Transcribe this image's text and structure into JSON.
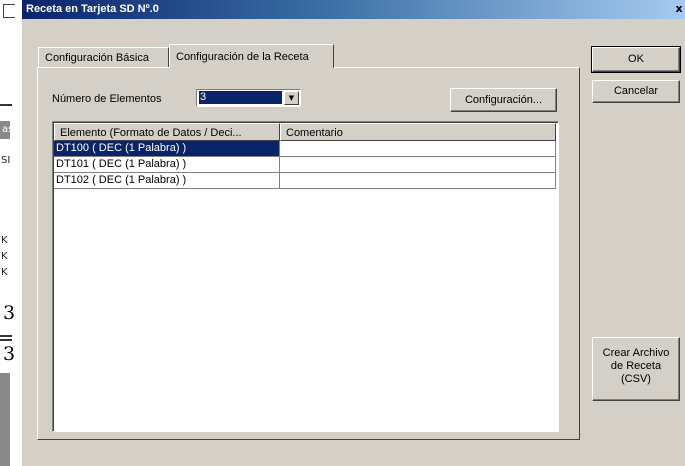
{
  "window": {
    "title": "Receta en Tarjeta SD Nº.0",
    "close_glyph": "x"
  },
  "tabs": [
    {
      "label": "Configuración Básica",
      "active": false
    },
    {
      "label": "Configuración de la Receta",
      "active": true
    }
  ],
  "recipe": {
    "count_label": "Número de Elementos",
    "count_value": "3",
    "config_button": "Configuración...",
    "columns": [
      "Elemento (Formato de Datos / Deci...",
      "Comentario"
    ],
    "rows": [
      {
        "element": "DT100 ( DEC (1 Palabra) )",
        "comment": "",
        "selected": true
      },
      {
        "element": "DT101 ( DEC (1 Palabra) )",
        "comment": "",
        "selected": false
      },
      {
        "element": "DT102 ( DEC (1 Palabra) )",
        "comment": "",
        "selected": false
      }
    ]
  },
  "buttons": {
    "ok": "OK",
    "cancel": "Cancelar",
    "csv_lines": [
      "Crear Archivo",
      "de Receta",
      "(CSV)"
    ]
  },
  "background_app": {
    "fragments": [
      "as",
      "SI",
      "K",
      "K",
      "K"
    ]
  },
  "colors": {
    "title_bar": "#0a246a",
    "selection": "#0a246a",
    "face": "#d4d0c8"
  }
}
